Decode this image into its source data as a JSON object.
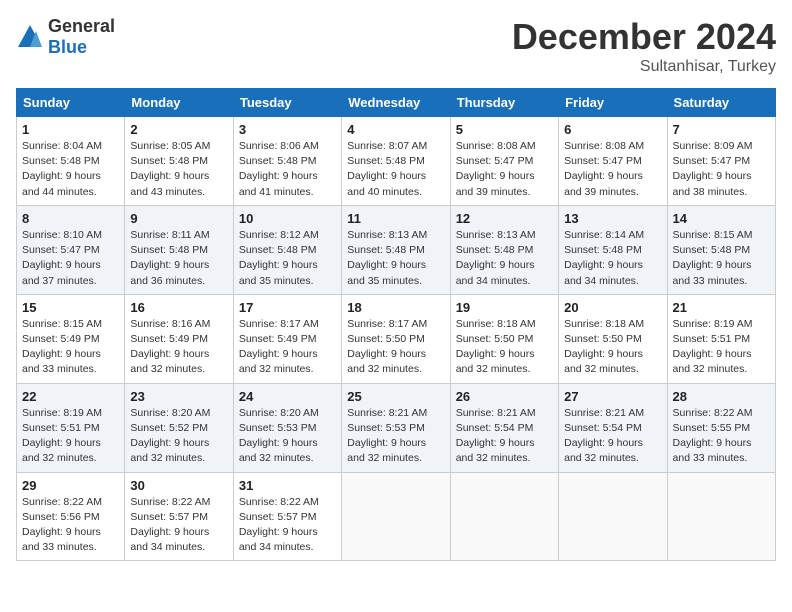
{
  "logo": {
    "text_general": "General",
    "text_blue": "Blue"
  },
  "title": "December 2024",
  "location": "Sultanhisar, Turkey",
  "days_of_week": [
    "Sunday",
    "Monday",
    "Tuesday",
    "Wednesday",
    "Thursday",
    "Friday",
    "Saturday"
  ],
  "weeks": [
    [
      {
        "day": 1,
        "sunrise": "8:04 AM",
        "sunset": "5:48 PM",
        "daylight": "9 hours and 44 minutes."
      },
      {
        "day": 2,
        "sunrise": "8:05 AM",
        "sunset": "5:48 PM",
        "daylight": "9 hours and 43 minutes."
      },
      {
        "day": 3,
        "sunrise": "8:06 AM",
        "sunset": "5:48 PM",
        "daylight": "9 hours and 41 minutes."
      },
      {
        "day": 4,
        "sunrise": "8:07 AM",
        "sunset": "5:48 PM",
        "daylight": "9 hours and 40 minutes."
      },
      {
        "day": 5,
        "sunrise": "8:08 AM",
        "sunset": "5:47 PM",
        "daylight": "9 hours and 39 minutes."
      },
      {
        "day": 6,
        "sunrise": "8:08 AM",
        "sunset": "5:47 PM",
        "daylight": "9 hours and 39 minutes."
      },
      {
        "day": 7,
        "sunrise": "8:09 AM",
        "sunset": "5:47 PM",
        "daylight": "9 hours and 38 minutes."
      }
    ],
    [
      {
        "day": 8,
        "sunrise": "8:10 AM",
        "sunset": "5:47 PM",
        "daylight": "9 hours and 37 minutes."
      },
      {
        "day": 9,
        "sunrise": "8:11 AM",
        "sunset": "5:48 PM",
        "daylight": "9 hours and 36 minutes."
      },
      {
        "day": 10,
        "sunrise": "8:12 AM",
        "sunset": "5:48 PM",
        "daylight": "9 hours and 35 minutes."
      },
      {
        "day": 11,
        "sunrise": "8:13 AM",
        "sunset": "5:48 PM",
        "daylight": "9 hours and 35 minutes."
      },
      {
        "day": 12,
        "sunrise": "8:13 AM",
        "sunset": "5:48 PM",
        "daylight": "9 hours and 34 minutes."
      },
      {
        "day": 13,
        "sunrise": "8:14 AM",
        "sunset": "5:48 PM",
        "daylight": "9 hours and 34 minutes."
      },
      {
        "day": 14,
        "sunrise": "8:15 AM",
        "sunset": "5:48 PM",
        "daylight": "9 hours and 33 minutes."
      }
    ],
    [
      {
        "day": 15,
        "sunrise": "8:15 AM",
        "sunset": "5:49 PM",
        "daylight": "9 hours and 33 minutes."
      },
      {
        "day": 16,
        "sunrise": "8:16 AM",
        "sunset": "5:49 PM",
        "daylight": "9 hours and 32 minutes."
      },
      {
        "day": 17,
        "sunrise": "8:17 AM",
        "sunset": "5:49 PM",
        "daylight": "9 hours and 32 minutes."
      },
      {
        "day": 18,
        "sunrise": "8:17 AM",
        "sunset": "5:50 PM",
        "daylight": "9 hours and 32 minutes."
      },
      {
        "day": 19,
        "sunrise": "8:18 AM",
        "sunset": "5:50 PM",
        "daylight": "9 hours and 32 minutes."
      },
      {
        "day": 20,
        "sunrise": "8:18 AM",
        "sunset": "5:50 PM",
        "daylight": "9 hours and 32 minutes."
      },
      {
        "day": 21,
        "sunrise": "8:19 AM",
        "sunset": "5:51 PM",
        "daylight": "9 hours and 32 minutes."
      }
    ],
    [
      {
        "day": 22,
        "sunrise": "8:19 AM",
        "sunset": "5:51 PM",
        "daylight": "9 hours and 32 minutes."
      },
      {
        "day": 23,
        "sunrise": "8:20 AM",
        "sunset": "5:52 PM",
        "daylight": "9 hours and 32 minutes."
      },
      {
        "day": 24,
        "sunrise": "8:20 AM",
        "sunset": "5:53 PM",
        "daylight": "9 hours and 32 minutes."
      },
      {
        "day": 25,
        "sunrise": "8:21 AM",
        "sunset": "5:53 PM",
        "daylight": "9 hours and 32 minutes."
      },
      {
        "day": 26,
        "sunrise": "8:21 AM",
        "sunset": "5:54 PM",
        "daylight": "9 hours and 32 minutes."
      },
      {
        "day": 27,
        "sunrise": "8:21 AM",
        "sunset": "5:54 PM",
        "daylight": "9 hours and 32 minutes."
      },
      {
        "day": 28,
        "sunrise": "8:22 AM",
        "sunset": "5:55 PM",
        "daylight": "9 hours and 33 minutes."
      }
    ],
    [
      {
        "day": 29,
        "sunrise": "8:22 AM",
        "sunset": "5:56 PM",
        "daylight": "9 hours and 33 minutes."
      },
      {
        "day": 30,
        "sunrise": "8:22 AM",
        "sunset": "5:57 PM",
        "daylight": "9 hours and 34 minutes."
      },
      {
        "day": 31,
        "sunrise": "8:22 AM",
        "sunset": "5:57 PM",
        "daylight": "9 hours and 34 minutes."
      },
      null,
      null,
      null,
      null
    ]
  ]
}
